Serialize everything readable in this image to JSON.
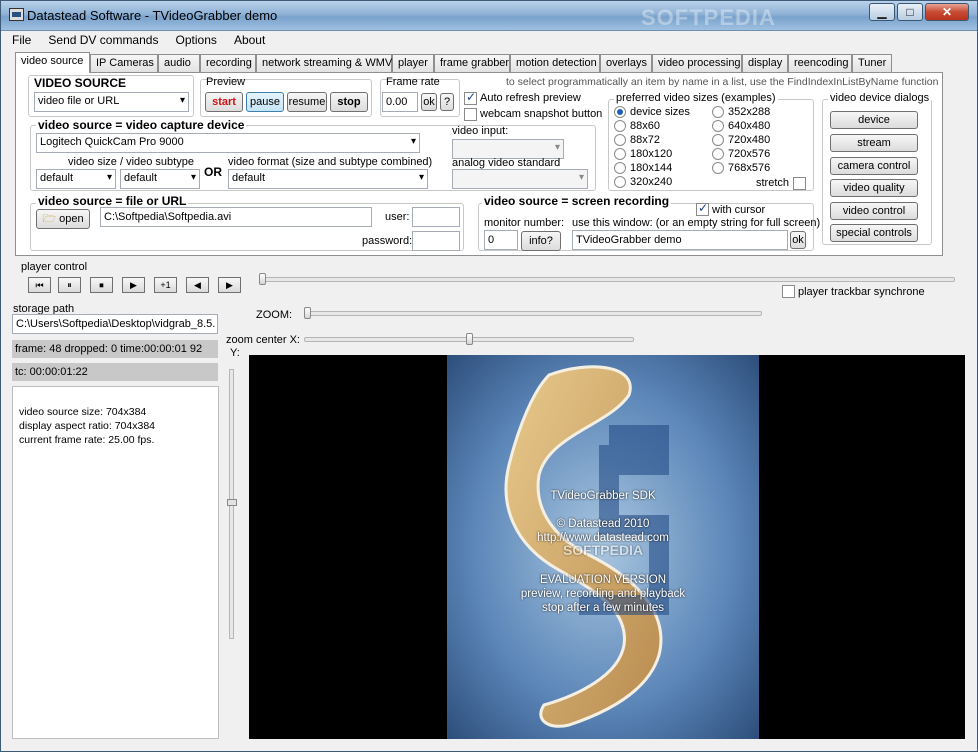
{
  "window": {
    "title": "Datastead Software - TVideoGrabber demo",
    "minimize": "▁",
    "maximize": "□",
    "close": "✕",
    "watermark": "SOFTPEDIA"
  },
  "menu": [
    "File",
    "Send DV commands",
    "Options",
    "About"
  ],
  "tabs": [
    "video source",
    "IP Cameras",
    "audio",
    "recording",
    "network streaming & WMV",
    "player",
    "frame grabber",
    "motion detection",
    "overlays",
    "video processing",
    "display",
    "reencoding",
    "Tuner"
  ],
  "video_source": {
    "heading": "VIDEO SOURCE",
    "combo": "video file or URL",
    "preview_label": "Preview",
    "start": "start",
    "pause": "pause",
    "resume": "resume",
    "stop": "stop",
    "frame_rate_label": "Frame rate",
    "frame_rate_value": "0.00",
    "ok": "ok",
    "help": "?",
    "auto_refresh": "Auto refresh preview",
    "webcam_snapshot": "webcam snapshot button",
    "hint": "to select programmatically an item by name in a list, use the FindIndexInListByName function"
  },
  "capture": {
    "heading": "video source = video capture device",
    "device": "Logitech QuickCam Pro 9000",
    "size_label": "video size / video subtype",
    "size_value": "default",
    "subtype_value": "default",
    "or": "OR",
    "format_label": "video format (size and subtype combined)",
    "format_value": "default",
    "input_label": "video input:",
    "analog_label": "analog video standard"
  },
  "preferred_sizes": {
    "label": "preferred video sizes (examples)",
    "col1": [
      "device sizes",
      "88x60",
      "88x72",
      "180x120",
      "180x144",
      "320x240"
    ],
    "col2": [
      "352x288",
      "640x480",
      "720x480",
      "720x576",
      "768x576"
    ],
    "stretch": "stretch"
  },
  "device_dialogs": {
    "label": "video device dialogs",
    "buttons": [
      "device",
      "stream",
      "camera control",
      "video quality",
      "video control",
      "special controls"
    ]
  },
  "file_url": {
    "heading": "video source = file or URL",
    "open": "open",
    "path": "C:\\Softpedia\\Softpedia.avi",
    "user_label": "user:",
    "password_label": "password:"
  },
  "screen_rec": {
    "heading": "video source = screen recording",
    "with_cursor": "with cursor",
    "monitor_label": "monitor number:",
    "monitor_value": "0",
    "info": "info?",
    "window_label": "use this window: (or an empty string for full screen)",
    "window_value": "TVideoGrabber demo",
    "ok": "ok"
  },
  "player": {
    "label": "player control",
    "buttons": [
      "⏮",
      "⏸",
      "⏹",
      "▶",
      "+1",
      "◀",
      "▶"
    ],
    "synchrone": "player trackbar synchrone"
  },
  "storage": {
    "label": "storage path",
    "path": "C:\\Users\\Softpedia\\Desktop\\vidgrab_8.5.",
    "frame_status": "frame: 48 dropped: 0 time:00:00:01 92",
    "tc": "tc: 00:00:01:22",
    "info1": "video source size: 704x384",
    "info2": "display aspect ratio: 704x384",
    "info3": "current frame rate: 25.00 fps."
  },
  "zoom": {
    "label": "ZOOM:",
    "center_x": "zoom center X:",
    "y": "Y:"
  },
  "overlay": {
    "line1": "TVideoGrabber SDK",
    "line2": "© Datastead 2010",
    "line3": "http://www.datastead.com",
    "line4": "EVALUATION VERSION",
    "line5": "preview, recording and playback",
    "line6": "stop after a few minutes",
    "watermark": "SOFTPEDIA"
  }
}
